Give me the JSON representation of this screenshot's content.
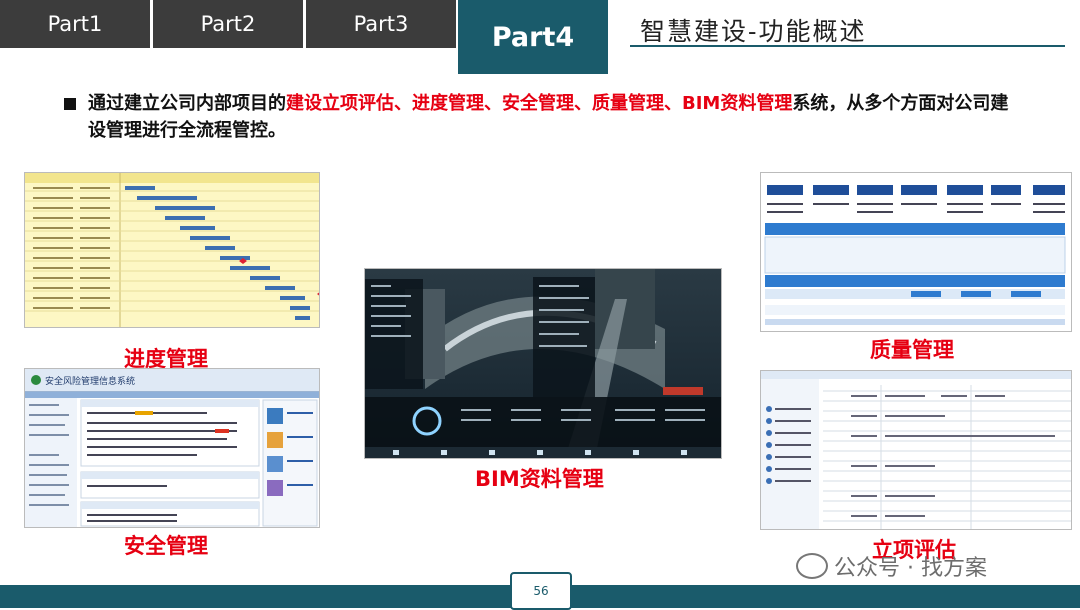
{
  "tabs": [
    "Part1",
    "Part2",
    "Part3"
  ],
  "active_tab": "Part4",
  "title": "智慧建设-功能概述",
  "intro": {
    "prefix": "通过建立公司内部项目的",
    "highlight": "建设立项评估、进度管理、安全管理、质量管理、BIM资料管理",
    "suffix": "系统，从多个方面对公司建设管理进行全流程管控。"
  },
  "captions": {
    "schedule": "进度管理",
    "safety": "安全管理",
    "bim": "BIM资料管理",
    "quality": "质量管理",
    "project": "立项评估"
  },
  "safety_screen_title": "安全风险管理信息系统",
  "page_number": "56",
  "watermark": "公众号 · 找方案",
  "colors": {
    "accent": "#1a5b6b",
    "highlight": "#e60012",
    "tab_bg": "#3c3c3c"
  }
}
